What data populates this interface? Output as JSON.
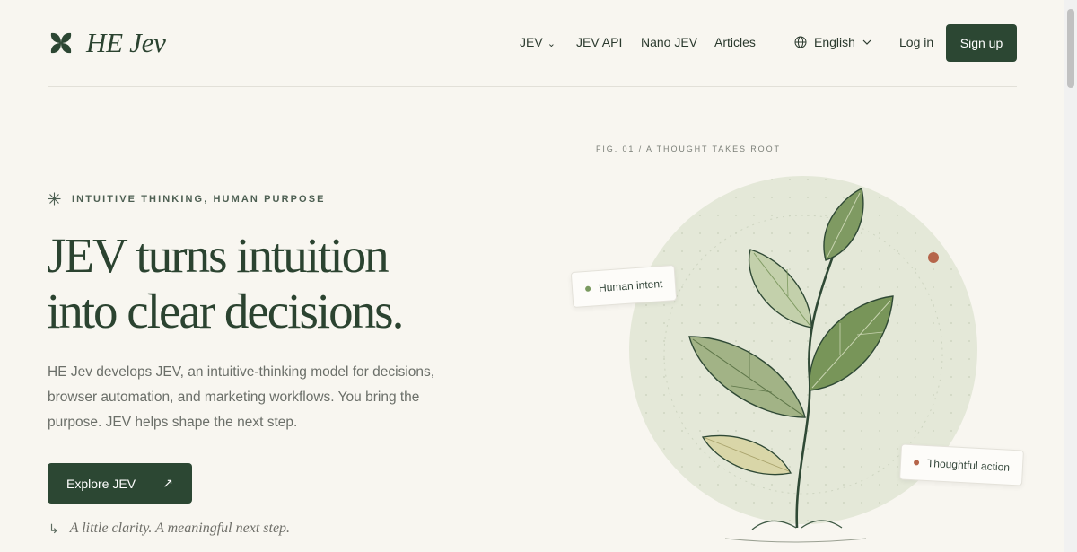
{
  "brand": {
    "name": "HE Jev"
  },
  "nav": {
    "items": [
      {
        "label": "JEV",
        "has_dropdown": true
      },
      {
        "label": "JEV API"
      },
      {
        "label": "Nano JEV"
      },
      {
        "label": "Articles"
      }
    ],
    "language": "English",
    "login": "Log in",
    "signup": "Sign up"
  },
  "hero": {
    "eyebrow": "INTUITIVE THINKING, HUMAN PURPOSE",
    "headline_line1": "JEV turns intuition",
    "headline_line2": "into clear decisions.",
    "description": "HE Jev develops JEV, an intuitive-thinking model for decisions, browser automation, and marketing workflows. You bring the purpose. JEV helps shape the next step.",
    "cta_label": "Explore JEV",
    "cta_arrow": "↗",
    "tagline_arrow": "↳",
    "tagline": "A little clarity. A meaningful next step."
  },
  "figure": {
    "caption": "FIG. 01 / A THOUGHT TAKES ROOT",
    "chip_intent": "Human intent",
    "chip_action": "Thoughtful action"
  },
  "colors": {
    "brand_green": "#2c4733",
    "background": "#f8f6f0",
    "intent_dot": "#7a9a60",
    "action_dot": "#b5654a",
    "circle_fill": "#e4e8d8"
  }
}
